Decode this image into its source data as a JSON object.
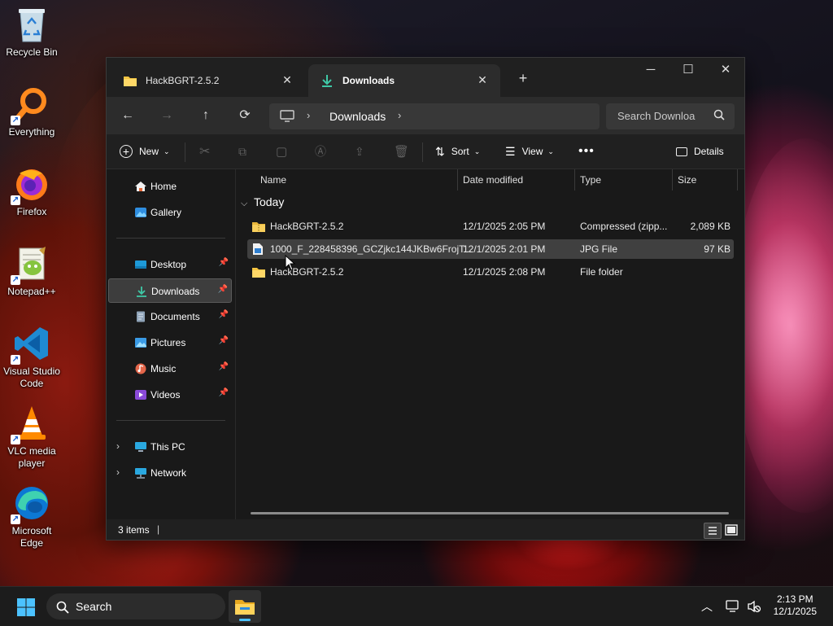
{
  "desktop": {
    "icons": [
      {
        "label": "Recycle Bin",
        "icon": "recycle-bin-icon"
      },
      {
        "label": "Everything",
        "icon": "everything-icon"
      },
      {
        "label": "Firefox",
        "icon": "firefox-icon"
      },
      {
        "label": "Notepad++",
        "icon": "notepad-plus-plus-icon"
      },
      {
        "label": "Visual Studio Code",
        "icon": "vscode-icon"
      },
      {
        "label": "VLC media player",
        "icon": "vlc-icon"
      },
      {
        "label": "Microsoft Edge",
        "icon": "edge-icon"
      }
    ]
  },
  "explorer": {
    "tabs": [
      {
        "label": "HackBGRT-2.5.2",
        "icon": "folder-icon",
        "active": false
      },
      {
        "label": "Downloads",
        "icon": "download-icon",
        "active": true
      }
    ],
    "address": {
      "segment": "Downloads"
    },
    "search": {
      "placeholder": "Search Downloa"
    },
    "toolbar": {
      "new_label": "New",
      "sort_label": "Sort",
      "view_label": "View",
      "details_label": "Details"
    },
    "nav": {
      "quick": [
        {
          "label": "Home",
          "icon": "home-icon"
        },
        {
          "label": "Gallery",
          "icon": "gallery-icon"
        }
      ],
      "pinned": [
        {
          "label": "Desktop",
          "icon": "desktop-icon"
        },
        {
          "label": "Downloads",
          "icon": "download-icon",
          "selected": true
        },
        {
          "label": "Documents",
          "icon": "documents-icon"
        },
        {
          "label": "Pictures",
          "icon": "pictures-icon"
        },
        {
          "label": "Music",
          "icon": "music-icon"
        },
        {
          "label": "Videos",
          "icon": "videos-icon"
        }
      ],
      "roots": [
        {
          "label": "This PC",
          "icon": "pc-icon"
        },
        {
          "label": "Network",
          "icon": "network-icon"
        }
      ]
    },
    "columns": {
      "name": "Name",
      "date": "Date modified",
      "type": "Type",
      "size": "Size"
    },
    "group": "Today",
    "files": [
      {
        "name": "HackBGRT-2.5.2",
        "date": "12/1/2025 2:05 PM",
        "type": "Compressed (zipp...",
        "size": "2,089 KB",
        "icon": "zip-folder-icon"
      },
      {
        "name": "1000_F_228458396_GCZjkc144JKBw6FrojT...",
        "date": "12/1/2025 2:01 PM",
        "type": "JPG File",
        "size": "97 KB",
        "icon": "image-file-icon",
        "selected": true
      },
      {
        "name": "HackBGRT-2.5.2",
        "date": "12/1/2025 2:08 PM",
        "type": "File folder",
        "size": "",
        "icon": "folder-icon"
      }
    ],
    "status": {
      "items": "3 items"
    }
  },
  "taskbar": {
    "search_label": "Search",
    "time": "2:13 PM",
    "date": "12/1/2025"
  }
}
